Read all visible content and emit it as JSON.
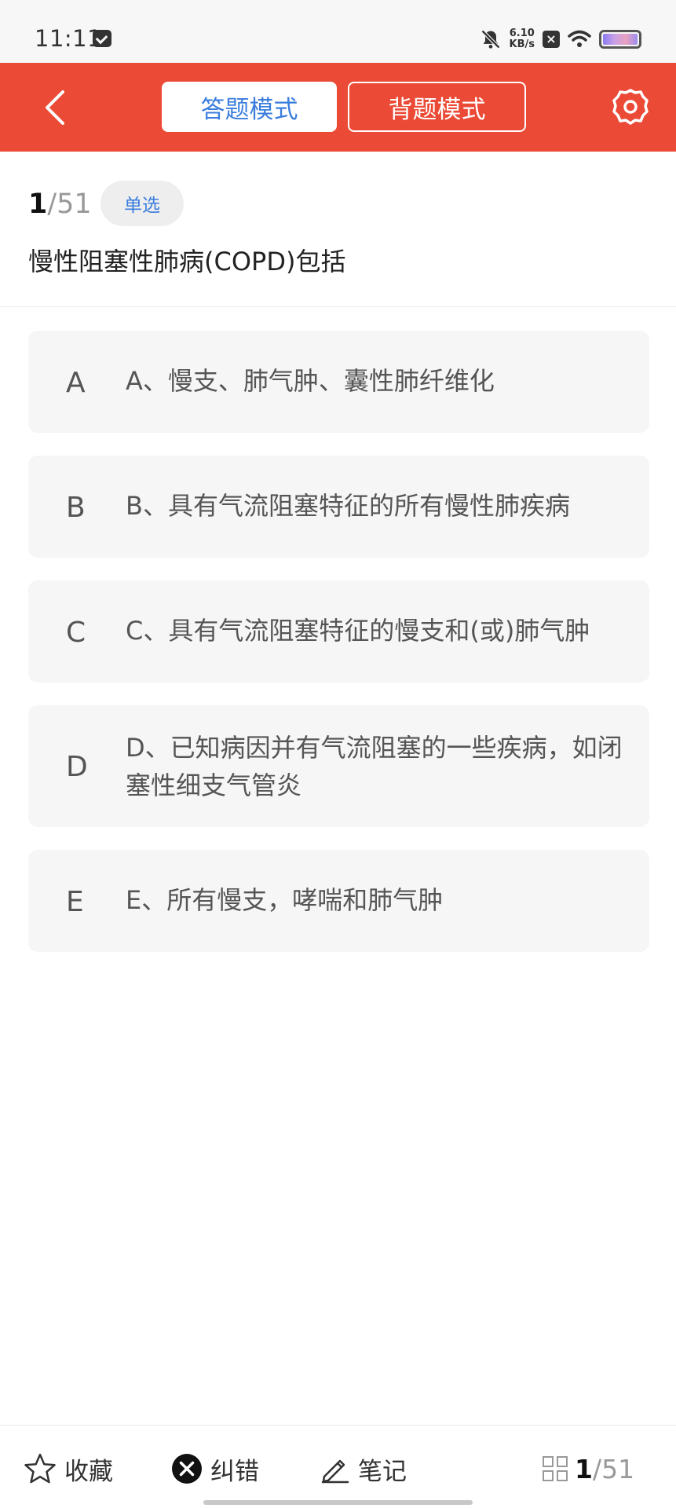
{
  "status_bar": {
    "time": "11:11",
    "speed_value": "6.10",
    "speed_unit": "KB/s",
    "icons": [
      "message-icon",
      "mute-bell-icon",
      "no-sim-icon",
      "wifi-icon",
      "battery-icon"
    ]
  },
  "header": {
    "back_icon": "chevron-left-icon",
    "tabs": [
      {
        "label": "答题模式",
        "active": true
      },
      {
        "label": "背题模式",
        "active": false
      }
    ],
    "settings_icon": "gear-icon",
    "bg_color": "#eb4a36",
    "accent_color": "#3b7ddd"
  },
  "question": {
    "current": "1",
    "total": "/51",
    "type": "单选",
    "text": "慢性阻塞性肺病(COPD)包括"
  },
  "options": [
    {
      "letter": "A",
      "text": "A、慢支、肺气肿、囊性肺纤维化"
    },
    {
      "letter": "B",
      "text": "B、具有气流阻塞特征的所有慢性肺疾病"
    },
    {
      "letter": "C",
      "text": "C、具有气流阻塞特征的慢支和(或)肺气肿"
    },
    {
      "letter": "D",
      "text": "D、已知病因并有气流阻塞的一些疾病，如闭塞性细支气管炎"
    },
    {
      "letter": "E",
      "text": "E、所有慢支，哮喘和肺气肿"
    }
  ],
  "bottom_bar": {
    "favorite_label": "收藏",
    "report_label": "纠错",
    "note_label": "笔记",
    "counter_current": "1",
    "counter_total": "/51",
    "icons": [
      "star-icon",
      "close-circle-icon",
      "pencil-icon",
      "grid-icon"
    ]
  }
}
